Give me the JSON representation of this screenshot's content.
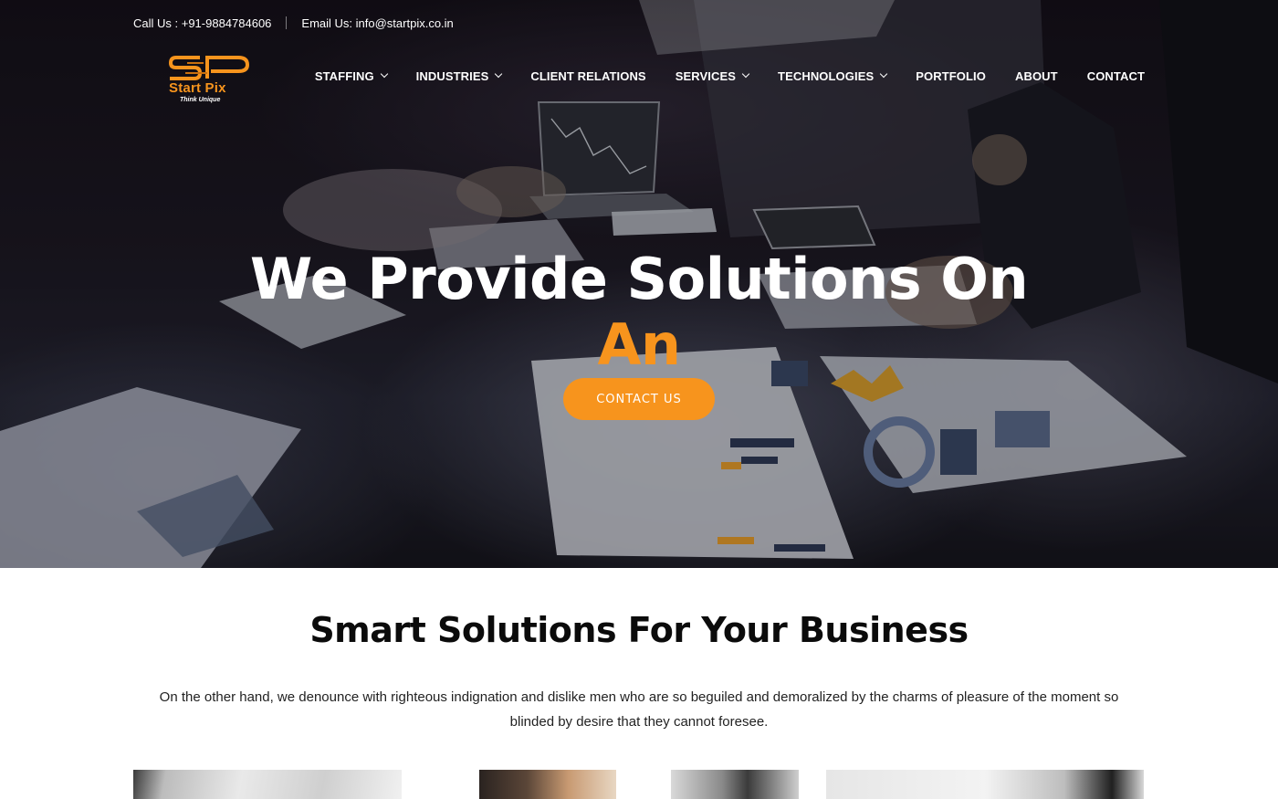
{
  "topbar": {
    "phone": "Call Us : +91-9884784606",
    "email": "Email Us: info@startpix.co.in"
  },
  "logo": {
    "name": "Start Pix",
    "tagline": "Think Unique"
  },
  "nav": [
    {
      "label": "STAFFING",
      "dropdown": true
    },
    {
      "label": "INDUSTRIES",
      "dropdown": true
    },
    {
      "label": "CLIENT RELATIONS",
      "dropdown": false
    },
    {
      "label": "SERVICES",
      "dropdown": true
    },
    {
      "label": "TECHNOLOGIES",
      "dropdown": true
    },
    {
      "label": "PORTFOLIO",
      "dropdown": false
    },
    {
      "label": "ABOUT",
      "dropdown": false
    },
    {
      "label": "CONTACT",
      "dropdown": false
    }
  ],
  "hero": {
    "headline_line1": "We Provide Solutions On",
    "headline_line2": "An",
    "cta_label": "CONTACT US"
  },
  "section": {
    "title": "Smart Solutions For Your Business",
    "text": "On the other hand, we denounce with righteous indignation and dislike men who are so beguiled and demoralized by the charms of pleasure of the moment so blinded by desire that they cannot foresee."
  },
  "colors": {
    "accent": "#f7941d",
    "text_dark": "#0b0b0b",
    "white": "#ffffff"
  }
}
